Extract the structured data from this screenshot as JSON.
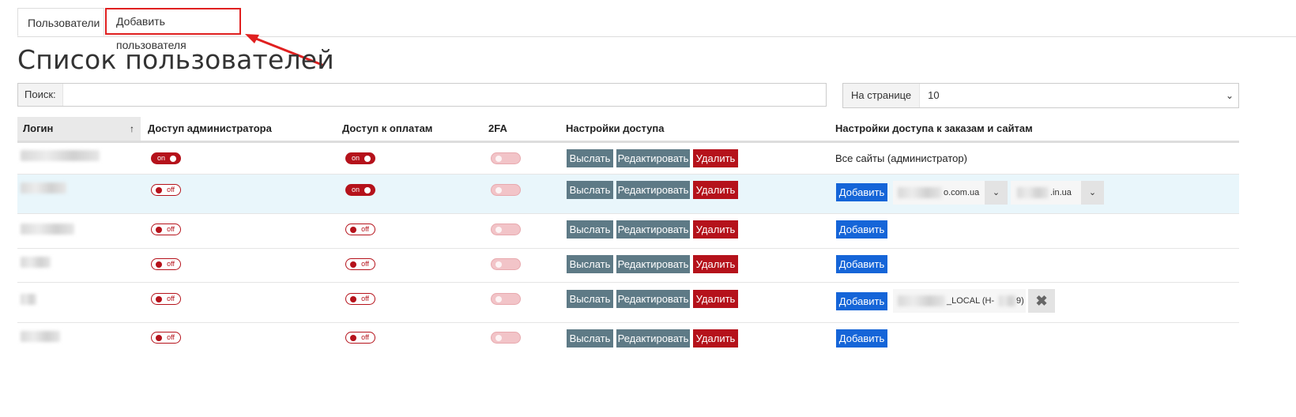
{
  "tabs": {
    "users": "Пользователи",
    "add_user": "Добавить пользователя"
  },
  "page_title": "Список пользователей",
  "search": {
    "label": "Поиск:",
    "value": ""
  },
  "per_page": {
    "label": "На странице",
    "value": "10"
  },
  "columns": {
    "login": "Логин",
    "admin": "Доступ администратора",
    "payments": "Доступ к оплатам",
    "twofa": "2FA",
    "access": "Настройки доступа",
    "orders": "Настройки доступа к заказам и сайтам"
  },
  "sort_indicator": "↑",
  "toggle_text": {
    "on": "on",
    "off": "off"
  },
  "buttons": {
    "send": "Выслать",
    "edit": "Редактировать",
    "delete": "Удалить",
    "add": "Добавить"
  },
  "rows": [
    {
      "admin": "on",
      "payments": "on",
      "twofa": "disabled",
      "orders_text": "Все сайты (администратор)"
    },
    {
      "admin": "off",
      "payments": "on",
      "twofa": "disabled",
      "sites": [
        "o.com.ua",
        ".in.ua"
      ]
    },
    {
      "admin": "off",
      "payments": "off",
      "twofa": "disabled"
    },
    {
      "admin": "off",
      "payments": "off",
      "twofa": "disabled"
    },
    {
      "admin": "off",
      "payments": "off",
      "twofa": "disabled",
      "site_chip": "_LOCAL (H-",
      "site_chip_end": "9)"
    },
    {
      "admin": "off",
      "payments": "off",
      "twofa": "disabled"
    }
  ],
  "colors": {
    "danger": "#b5121b",
    "slate": "#5e7a86",
    "primary": "#1565d8",
    "highlight": "#e9f6fb",
    "annotation": "#e02020"
  },
  "icons": {
    "close": "close-icon",
    "chevron": "chevron-down-icon"
  }
}
